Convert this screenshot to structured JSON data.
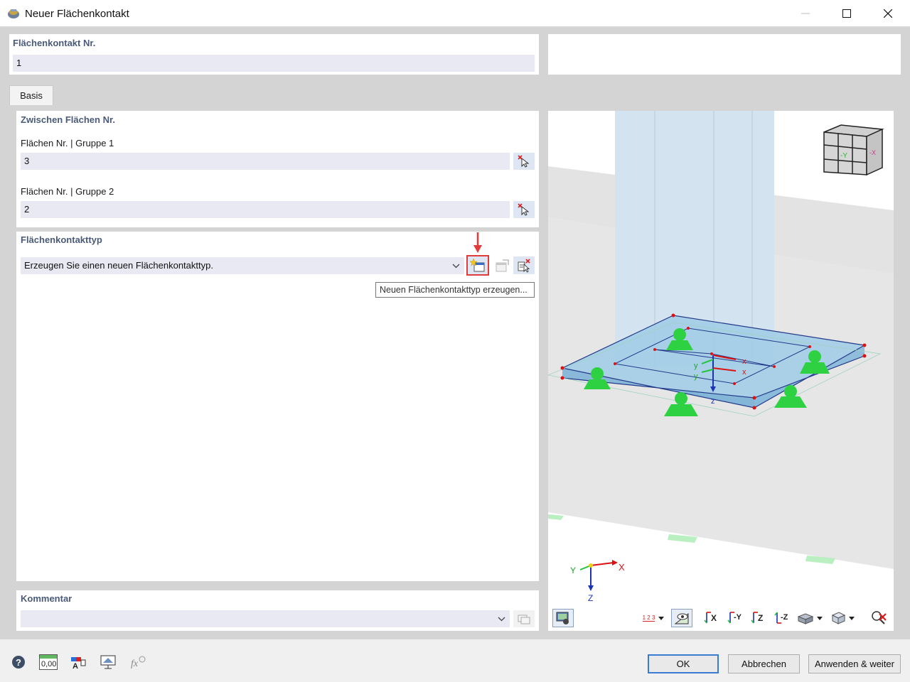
{
  "window": {
    "title": "Neuer Flächenkontakt"
  },
  "header": {
    "number_label": "Flächenkontakt Nr.",
    "number_value": "1"
  },
  "tabs": [
    {
      "label": "Basis"
    }
  ],
  "between_surfaces": {
    "title": "Zwischen Flächen Nr.",
    "group1_label": "Flächen Nr. | Gruppe 1",
    "group1_value": "3",
    "group2_label": "Flächen Nr. | Gruppe 2",
    "group2_value": "2"
  },
  "contact_type": {
    "title": "Flächenkontakttyp",
    "selected": "Erzeugen Sie einen neuen Flächenkontakttyp.",
    "tooltip": "Neuen Flächenkontakttyp erzeugen..."
  },
  "comment": {
    "title": "Kommentar",
    "value": ""
  },
  "viewport": {
    "axes": {
      "x": "x",
      "y": "y",
      "z": "z",
      "X": "X",
      "Y": "Y",
      "Z": "Z"
    },
    "cube_labels": {
      "left": "-Y",
      "right": "-X"
    },
    "toolbar": {
      "numbering": "1 2 3",
      "view_x": "X",
      "view_y": "-Y",
      "view_z": "Z",
      "view_minus_z": "-Z"
    }
  },
  "footer": {
    "zero_label": "0,00",
    "ok": "OK",
    "cancel": "Abbrechen",
    "apply_next": "Anwenden & weiter"
  },
  "colors": {
    "section_title": "#4a5a78",
    "field_bg": "#e8e9f3",
    "highlight_red": "#e23b3b",
    "support_green": "#2ed142",
    "slab_blue": "#9fcbe6"
  }
}
